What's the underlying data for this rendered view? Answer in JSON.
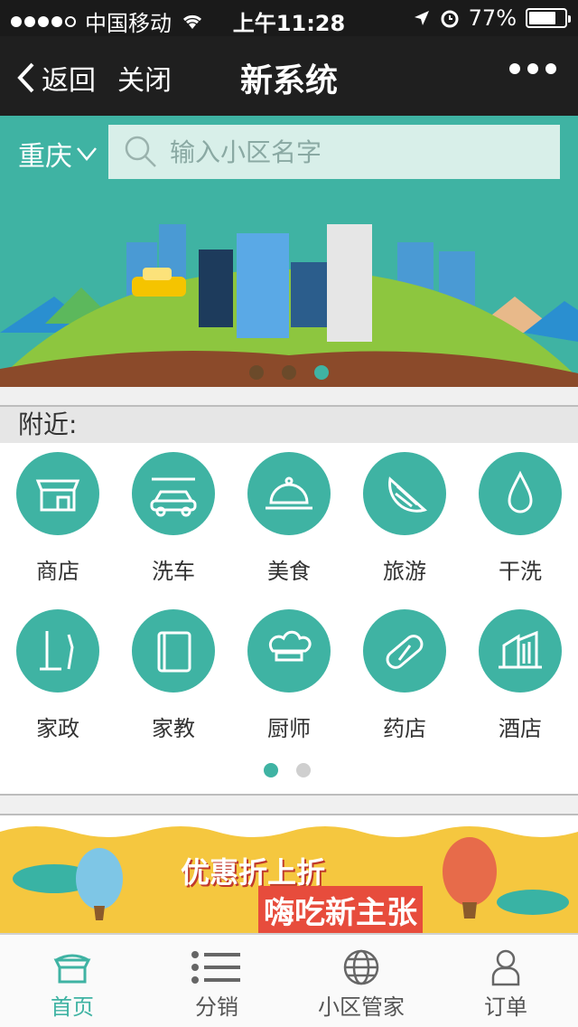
{
  "status": {
    "carrier": "中国移动",
    "time": "上午11:28",
    "battery": "77%",
    "battery_level": 0.77
  },
  "nav": {
    "back_label": "返回",
    "close_label": "关闭",
    "title": "新系统"
  },
  "search": {
    "city": "重庆",
    "placeholder": "输入小区名字"
  },
  "banner": {
    "page_count": 3,
    "active_index": 2
  },
  "nearby": {
    "header": "附近:",
    "items": [
      {
        "label": "商店",
        "icon": "shop-icon"
      },
      {
        "label": "洗车",
        "icon": "car-wash-icon"
      },
      {
        "label": "美食",
        "icon": "food-icon"
      },
      {
        "label": "旅游",
        "icon": "travel-icon"
      },
      {
        "label": "干洗",
        "icon": "dry-clean-icon"
      },
      {
        "label": "家政",
        "icon": "housekeeping-icon"
      },
      {
        "label": "家教",
        "icon": "tutor-icon"
      },
      {
        "label": "厨师",
        "icon": "chef-icon"
      },
      {
        "label": "药店",
        "icon": "pharmacy-icon"
      },
      {
        "label": "酒店",
        "icon": "hotel-icon"
      }
    ],
    "page_count": 2,
    "active_index": 0
  },
  "promo": {
    "title": "优惠折上折",
    "subtitle": "嗨吃新主张"
  },
  "tabs": [
    {
      "label": "首页",
      "icon": "store-icon",
      "active": true
    },
    {
      "label": "分销",
      "icon": "list-icon",
      "active": false
    },
    {
      "label": "小区管家",
      "icon": "globe-icon",
      "active": false
    },
    {
      "label": "订单",
      "icon": "user-icon",
      "active": false
    }
  ],
  "colors": {
    "accent": "#3fb3a3",
    "navbar": "#1f1f1f",
    "promo": "#f5c73f"
  }
}
